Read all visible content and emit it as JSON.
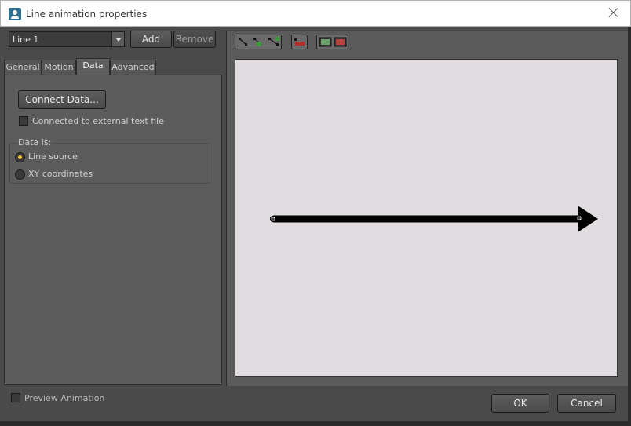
{
  "window": {
    "title": "Line animation properties"
  },
  "line_selector": {
    "value": "Line 1"
  },
  "buttons": {
    "add": "Add",
    "remove": "Remove",
    "connect_data": "Connect Data...",
    "ok": "OK",
    "cancel": "Cancel"
  },
  "tabs": [
    {
      "label": "General"
    },
    {
      "label": "Motion"
    },
    {
      "label": "Data"
    },
    {
      "label": "Advanced"
    }
  ],
  "active_tab": "Data",
  "data_tab": {
    "connected_external_label": "Connected to external text file",
    "connected_external_checked": false,
    "group_title": "Data is:",
    "options": [
      {
        "label": "Line source",
        "selected": true
      },
      {
        "label": "XY coordinates",
        "selected": false
      }
    ]
  },
  "preview": {
    "label": "Preview Animation",
    "checked": false
  },
  "toolbar_icons": [
    "node-select-icon",
    "add-node-icon",
    "insert-node-icon",
    "delete-node-icon",
    "zoom-fit-icon",
    "reset-view-icon"
  ],
  "colors": {
    "canvas_bg": "#e1dcdf",
    "arrow": "#000000",
    "radio_selected": "#f4c242"
  }
}
